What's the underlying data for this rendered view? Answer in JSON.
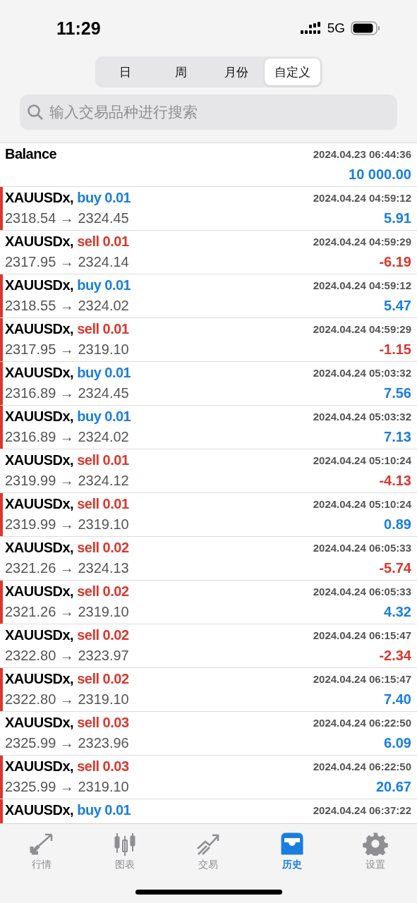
{
  "status_bar": {
    "time": "11:29",
    "network": "5G"
  },
  "period_tabs": [
    {
      "label": "日",
      "selected": false
    },
    {
      "label": "周",
      "selected": false
    },
    {
      "label": "月份",
      "selected": false
    },
    {
      "label": "自定义",
      "selected": true
    }
  ],
  "search": {
    "placeholder": "输入交易品种进行搜索"
  },
  "balance": {
    "title": "Balance",
    "time": "2024.04.23 06:44:36",
    "amount": "10 000.00"
  },
  "deals": [
    {
      "symbol": "XAUUSDx,",
      "kind": "buy",
      "order": "buy 0.01",
      "prices": "2318.54 → 2324.45",
      "time": "2024.04.24 04:59:12",
      "profit": "5.91",
      "color": "#1a7ee0",
      "marked": true
    },
    {
      "symbol": "XAUUSDx,",
      "kind": "sell",
      "order": "sell 0.01",
      "prices": "2317.95 → 2324.14",
      "time": "2024.04.24 04:59:29",
      "profit": "-6.19",
      "color": "#d9382e",
      "marked": false
    },
    {
      "symbol": "XAUUSDx,",
      "kind": "buy",
      "order": "buy 0.01",
      "prices": "2318.55 → 2324.02",
      "time": "2024.04.24 04:59:12",
      "profit": "5.47",
      "color": "#1a7ee0",
      "marked": true
    },
    {
      "symbol": "XAUUSDx,",
      "kind": "sell",
      "order": "sell 0.01",
      "prices": "2317.95 → 2319.10",
      "time": "2024.04.24 04:59:29",
      "profit": "-1.15",
      "color": "#d9382e",
      "marked": true
    },
    {
      "symbol": "XAUUSDx,",
      "kind": "buy",
      "order": "buy 0.01",
      "prices": "2316.89 → 2324.45",
      "time": "2024.04.24 05:03:32",
      "profit": "7.56",
      "color": "#1a7ee0",
      "marked": true
    },
    {
      "symbol": "XAUUSDx,",
      "kind": "buy",
      "order": "buy 0.01",
      "prices": "2316.89 → 2324.02",
      "time": "2024.04.24 05:03:32",
      "profit": "7.13",
      "color": "#1a7ee0",
      "marked": true
    },
    {
      "symbol": "XAUUSDx,",
      "kind": "sell",
      "order": "sell 0.01",
      "prices": "2319.99 → 2324.12",
      "time": "2024.04.24 05:10:24",
      "profit": "-4.13",
      "color": "#d9382e",
      "marked": false
    },
    {
      "symbol": "XAUUSDx,",
      "kind": "sell",
      "order": "sell 0.01",
      "prices": "2319.99 → 2319.10",
      "time": "2024.04.24 05:10:24",
      "profit": "0.89",
      "color": "#1a7ee0",
      "marked": true
    },
    {
      "symbol": "XAUUSDx,",
      "kind": "sell",
      "order": "sell 0.02",
      "prices": "2321.26 → 2324.13",
      "time": "2024.04.24 06:05:33",
      "profit": "-5.74",
      "color": "#d9382e",
      "marked": false
    },
    {
      "symbol": "XAUUSDx,",
      "kind": "sell",
      "order": "sell 0.02",
      "prices": "2321.26 → 2319.10",
      "time": "2024.04.24 06:05:33",
      "profit": "4.32",
      "color": "#1a7ee0",
      "marked": true
    },
    {
      "symbol": "XAUUSDx,",
      "kind": "sell",
      "order": "sell 0.02",
      "prices": "2322.80 → 2323.97",
      "time": "2024.04.24 06:15:47",
      "profit": "-2.34",
      "color": "#d9382e",
      "marked": false
    },
    {
      "symbol": "XAUUSDx,",
      "kind": "sell",
      "order": "sell 0.02",
      "prices": "2322.80 → 2319.10",
      "time": "2024.04.24 06:15:47",
      "profit": "7.40",
      "color": "#1a7ee0",
      "marked": true
    },
    {
      "symbol": "XAUUSDx,",
      "kind": "sell",
      "order": "sell 0.03",
      "prices": "2325.99 → 2323.96",
      "time": "2024.04.24 06:22:50",
      "profit": "6.09",
      "color": "#1a7ee0",
      "marked": false
    },
    {
      "symbol": "XAUUSDx,",
      "kind": "sell",
      "order": "sell 0.03",
      "prices": "2325.99 → 2319.10",
      "time": "2024.04.24 06:22:50",
      "profit": "20.67",
      "color": "#1a7ee0",
      "marked": true
    },
    {
      "symbol": "XAUUSDx,",
      "kind": "buy",
      "order": "buy 0.01",
      "time": "2024.04.24 06:37:22",
      "marked": true
    }
  ],
  "tab_bar": [
    {
      "label": "行情",
      "selected": false
    },
    {
      "label": "图表",
      "selected": false
    },
    {
      "label": "交易",
      "selected": false
    },
    {
      "label": "历史",
      "selected": true
    },
    {
      "label": "设置",
      "selected": false
    }
  ]
}
